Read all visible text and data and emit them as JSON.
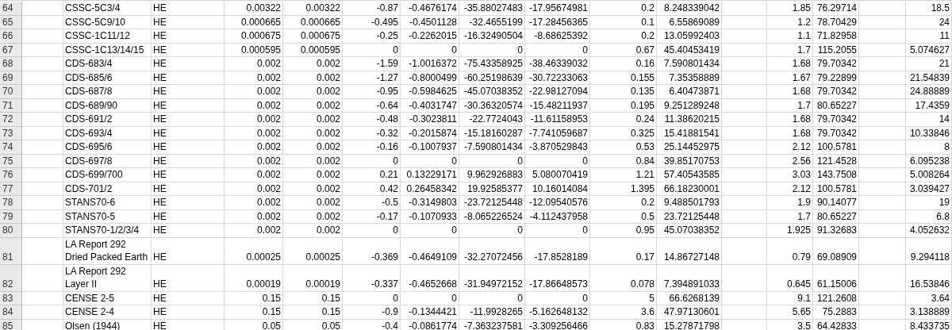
{
  "rows": [
    {
      "row_number": "64",
      "cells": {
        "B": "CSSC-5C3/4",
        "C": "HE",
        "D": "0.00322",
        "E": "0.00322",
        "F": "-0.87",
        "G": "-0.4676174",
        "H": "-35.88027483",
        "I": "-17.95674981",
        "J": "0.2",
        "K": "8.248339042",
        "M": "1.85",
        "N": "76.29714",
        "P": "18.5"
      }
    },
    {
      "row_number": "65",
      "cells": {
        "B": "CSSC-5C9/10",
        "C": "HE",
        "D": "0.000665",
        "E": "0.000665",
        "F": "-0.495",
        "G": "-0.4501128",
        "H": "-32.4655199",
        "I": "-17.28456365",
        "J": "0.1",
        "K": "6.55869089",
        "M": "1.2",
        "N": "78.70429",
        "P": "24"
      }
    },
    {
      "row_number": "66",
      "cells": {
        "B": "CSSC-1C11/12",
        "C": "HE",
        "D": "0.000675",
        "E": "0.000675",
        "F": "-0.25",
        "G": "-0.2262015",
        "H": "-16.32490504",
        "I": "-8.68625392",
        "J": "0.2",
        "K": "13.05992403",
        "M": "1.1",
        "N": "71.82958",
        "P": "11"
      }
    },
    {
      "row_number": "67",
      "cells": {
        "B": "CSSC-1C13/14/15",
        "C": "HE",
        "D": "0.000595",
        "E": "0.000595",
        "F": "0",
        "G": "0",
        "H": "0",
        "I": "0",
        "J": "0.67",
        "K": "45.40453419",
        "M": "1.7",
        "N": "115.2055",
        "P": "5.074627"
      }
    },
    {
      "row_number": "68",
      "cells": {
        "B": "CDS-683/4",
        "C": "HE",
        "D": "0.002",
        "E": "0.002",
        "F": "-1.59",
        "G": "-1.0016372",
        "H": "-75.43358925",
        "I": "-38.46339032",
        "J": "0.16",
        "K": "7.590801434",
        "M": "1.68",
        "N": "79.70342",
        "P": "21"
      }
    },
    {
      "row_number": "69",
      "cells": {
        "B": "CDS-685/6",
        "C": "HE",
        "D": "0.002",
        "E": "0.002",
        "F": "-1.27",
        "G": "-0.8000499",
        "H": "-60.25198639",
        "I": "-30.72233063",
        "J": "0.155",
        "K": "7.35358889",
        "M": "1.67",
        "N": "79.22899",
        "P": "21.54839"
      }
    },
    {
      "row_number": "70",
      "cells": {
        "B": "CDS-687/8",
        "C": "HE",
        "D": "0.002",
        "E": "0.002",
        "F": "-0.95",
        "G": "-0.5984625",
        "H": "-45.07038352",
        "I": "-22.98127094",
        "J": "0.135",
        "K": "6.40473871",
        "M": "1.68",
        "N": "79.70342",
        "P": "24.88889"
      }
    },
    {
      "row_number": "71",
      "cells": {
        "B": "CDS-689/90",
        "C": "HE",
        "D": "0.002",
        "E": "0.002",
        "F": "-0.64",
        "G": "-0.4031747",
        "H": "-30.36320574",
        "I": "-15.48211937",
        "J": "0.195",
        "K": "9.251289248",
        "M": "1.7",
        "N": "80.65227",
        "P": "17.4359"
      }
    },
    {
      "row_number": "72",
      "cells": {
        "B": "CDS-691/2",
        "C": "HE",
        "D": "0.002",
        "E": "0.002",
        "F": "-0.48",
        "G": "-0.3023811",
        "H": "-22.7724043",
        "I": "-11.61158953",
        "J": "0.24",
        "K": "11.38620215",
        "M": "1.68",
        "N": "79.70342",
        "P": "14"
      }
    },
    {
      "row_number": "73",
      "cells": {
        "B": "CDS-693/4",
        "C": "HE",
        "D": "0.002",
        "E": "0.002",
        "F": "-0.32",
        "G": "-0.2015874",
        "H": "-15.18160287",
        "I": "-7.741059687",
        "J": "0.325",
        "K": "15.41881541",
        "M": "1.68",
        "N": "79.70342",
        "P": "10.33846"
      }
    },
    {
      "row_number": "74",
      "cells": {
        "B": "CDS-695/6",
        "C": "HE",
        "D": "0.002",
        "E": "0.002",
        "F": "-0.16",
        "G": "-0.1007937",
        "H": "-7.590801434",
        "I": "-3.870529843",
        "J": "0.53",
        "K": "25.14452975",
        "M": "2.12",
        "N": "100.5781",
        "P": "8"
      }
    },
    {
      "row_number": "75",
      "cells": {
        "B": "CDS-697/8",
        "C": "HE",
        "D": "0.002",
        "E": "0.002",
        "F": "0",
        "G": "0",
        "H": "0",
        "I": "0",
        "J": "0.84",
        "K": "39.85170753",
        "M": "2.56",
        "N": "121.4528",
        "P": "6.095238"
      }
    },
    {
      "row_number": "76",
      "cells": {
        "B": "CDS-699/700",
        "C": "HE",
        "D": "0.002",
        "E": "0.002",
        "F": "0.21",
        "G": "0.13229171",
        "H": "9.962926883",
        "I": "5.080070419",
        "J": "1.21",
        "K": "57.40543585",
        "M": "3.03",
        "N": "143.7508",
        "P": "5.008264"
      }
    },
    {
      "row_number": "77",
      "cells": {
        "B": "CDS-701/2",
        "C": "HE",
        "D": "0.002",
        "E": "0.002",
        "F": "0.42",
        "G": "0.26458342",
        "H": "19.92585377",
        "I": "10.16014084",
        "J": "1.395",
        "K": "66.18230001",
        "M": "2.12",
        "N": "100.5781",
        "P": "3.039427"
      }
    },
    {
      "row_number": "78",
      "cells": {
        "B": "STANS70-6",
        "C": "HE",
        "D": "0.002",
        "E": "0.002",
        "F": "-0.5",
        "G": "-0.3149803",
        "H": "-23.72125448",
        "I": "-12.09540576",
        "J": "0.2",
        "K": "9.488501793",
        "M": "1.9",
        "N": "90.14077",
        "P": "19"
      }
    },
    {
      "row_number": "79",
      "cells": {
        "B": "STANS70-5",
        "C": "HE",
        "D": "0.002",
        "E": "0.002",
        "F": "-0.17",
        "G": "-0.1070933",
        "H": "-8.065226524",
        "I": "-4.112437958",
        "J": "0.5",
        "K": "23.72125448",
        "M": "1.7",
        "N": "80.65227",
        "P": "6.8"
      }
    },
    {
      "row_number": "80",
      "cells": {
        "B": "STANS70-1/2/3/4",
        "C": "HE",
        "D": "0.002",
        "E": "0.002",
        "F": "0",
        "G": "0",
        "H": "0",
        "I": "0",
        "J": "0.95",
        "K": "45.07038352",
        "M": "1.925",
        "N": "91.32683",
        "P": "4.052632"
      }
    },
    {
      "row_number": "81",
      "cells": {
        "B": "LA Report 292\nDried Packed Earth",
        "C": "HE",
        "D": "0.00025",
        "E": "0.00025",
        "F": "-0.369",
        "G": "-0.4649109",
        "H": "-32.27072456",
        "I": "-17.8528189",
        "J": "0.17",
        "K": "14.86727148",
        "M": "0.79",
        "N": "69.08909",
        "P": "9.294118"
      }
    },
    {
      "row_number": "82",
      "cells": {
        "B": "LA Report 292\nLayer II",
        "C": "HE",
        "D": "0.00019",
        "E": "0.00019",
        "F": "-0.337",
        "G": "-0.4652668",
        "H": "-31.94972152",
        "I": "-17.86648573",
        "J": "0.078",
        "K": "7.394891033",
        "M": "0.645",
        "N": "61.15006",
        "P": "16.53846"
      }
    },
    {
      "row_number": "83",
      "cells": {
        "B": "CENSE 2-5",
        "C": "HE",
        "D": "0.15",
        "E": "0.15",
        "F": "0",
        "G": "0",
        "H": "0",
        "I": "0",
        "J": "5",
        "K": "66.6268139",
        "M": "9.1",
        "N": "121.2608",
        "P": "3.64"
      }
    },
    {
      "row_number": "84",
      "cells": {
        "B": "CENSE 2-4",
        "C": "HE",
        "D": "0.15",
        "E": "0.15",
        "F": "-0.9",
        "G": "-0.1344421",
        "H": "-11.9928265",
        "I": "-5.162648132",
        "J": "3.6",
        "K": "47.97130601",
        "M": "5.65",
        "N": "75.2883",
        "P": "3.138889"
      }
    },
    {
      "row_number": "85",
      "cells": {
        "B": "Olsen (1944)",
        "C": "HE",
        "D": "0.05",
        "E": "0.05",
        "F": "-0.4",
        "G": "-0.0861774",
        "H": "-7.363237581",
        "I": "-3.309256466",
        "J": "0.83",
        "K": "15.27871798",
        "M": "3.5",
        "N": "64.42833",
        "P": "8.433735"
      }
    }
  ]
}
